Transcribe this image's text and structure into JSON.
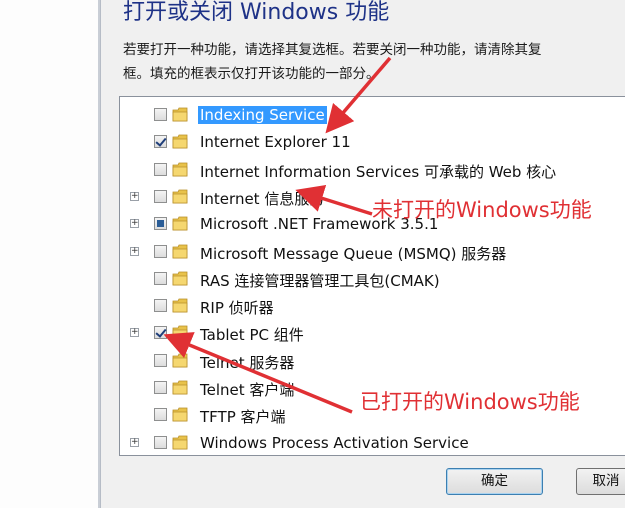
{
  "dialog": {
    "title": "打开或关闭 Windows 功能",
    "description_line1": "若要打开一种功能，请选择其复选框。若要关闭一种功能，请清除其复",
    "description_line2": "框。填充的框表示仅打开该功能的一部分。"
  },
  "features": [
    {
      "label": "Indexing Service",
      "state": "unchecked",
      "expandable": false,
      "selected": true,
      "icon": "folder-icon"
    },
    {
      "label": "Internet Explorer 11",
      "state": "checked",
      "expandable": false,
      "selected": false,
      "icon": "folder-icon"
    },
    {
      "label": "Internet Information Services 可承载的 Web 核心",
      "state": "unchecked",
      "expandable": false,
      "selected": false,
      "icon": "folder-icon"
    },
    {
      "label": "Internet 信息服务",
      "state": "unchecked",
      "expandable": true,
      "selected": false,
      "icon": "folder-icon"
    },
    {
      "label": "Microsoft .NET Framework 3.5.1",
      "state": "partial",
      "expandable": true,
      "selected": false,
      "icon": "folder-icon"
    },
    {
      "label": "Microsoft Message Queue (MSMQ) 服务器",
      "state": "unchecked",
      "expandable": true,
      "selected": false,
      "icon": "folder-icon"
    },
    {
      "label": "RAS 连接管理器管理工具包(CMAK)",
      "state": "unchecked",
      "expandable": false,
      "selected": false,
      "icon": "folder-icon"
    },
    {
      "label": "RIP 侦听器",
      "state": "unchecked",
      "expandable": false,
      "selected": false,
      "icon": "folder-icon"
    },
    {
      "label": "Tablet PC 组件",
      "state": "checked",
      "expandable": true,
      "selected": false,
      "icon": "folder-icon"
    },
    {
      "label": "Telnet 服务器",
      "state": "unchecked",
      "expandable": false,
      "selected": false,
      "icon": "folder-icon"
    },
    {
      "label": "Telnet 客户端",
      "state": "unchecked",
      "expandable": false,
      "selected": false,
      "icon": "folder-icon"
    },
    {
      "label": "TFTP 客户端",
      "state": "unchecked",
      "expandable": false,
      "selected": false,
      "icon": "folder-icon"
    },
    {
      "label": "Windows Process Activation Service",
      "state": "unchecked",
      "expandable": true,
      "selected": false,
      "icon": "folder-icon"
    }
  ],
  "buttons": {
    "ok": "确定",
    "cancel": "取消"
  },
  "annotations": {
    "not_enabled": "未打开的Windows功能",
    "enabled": "已打开的Windows功能"
  },
  "colors": {
    "annotation": "#e03034",
    "title": "#1e3287",
    "selection": "#3399ff"
  }
}
